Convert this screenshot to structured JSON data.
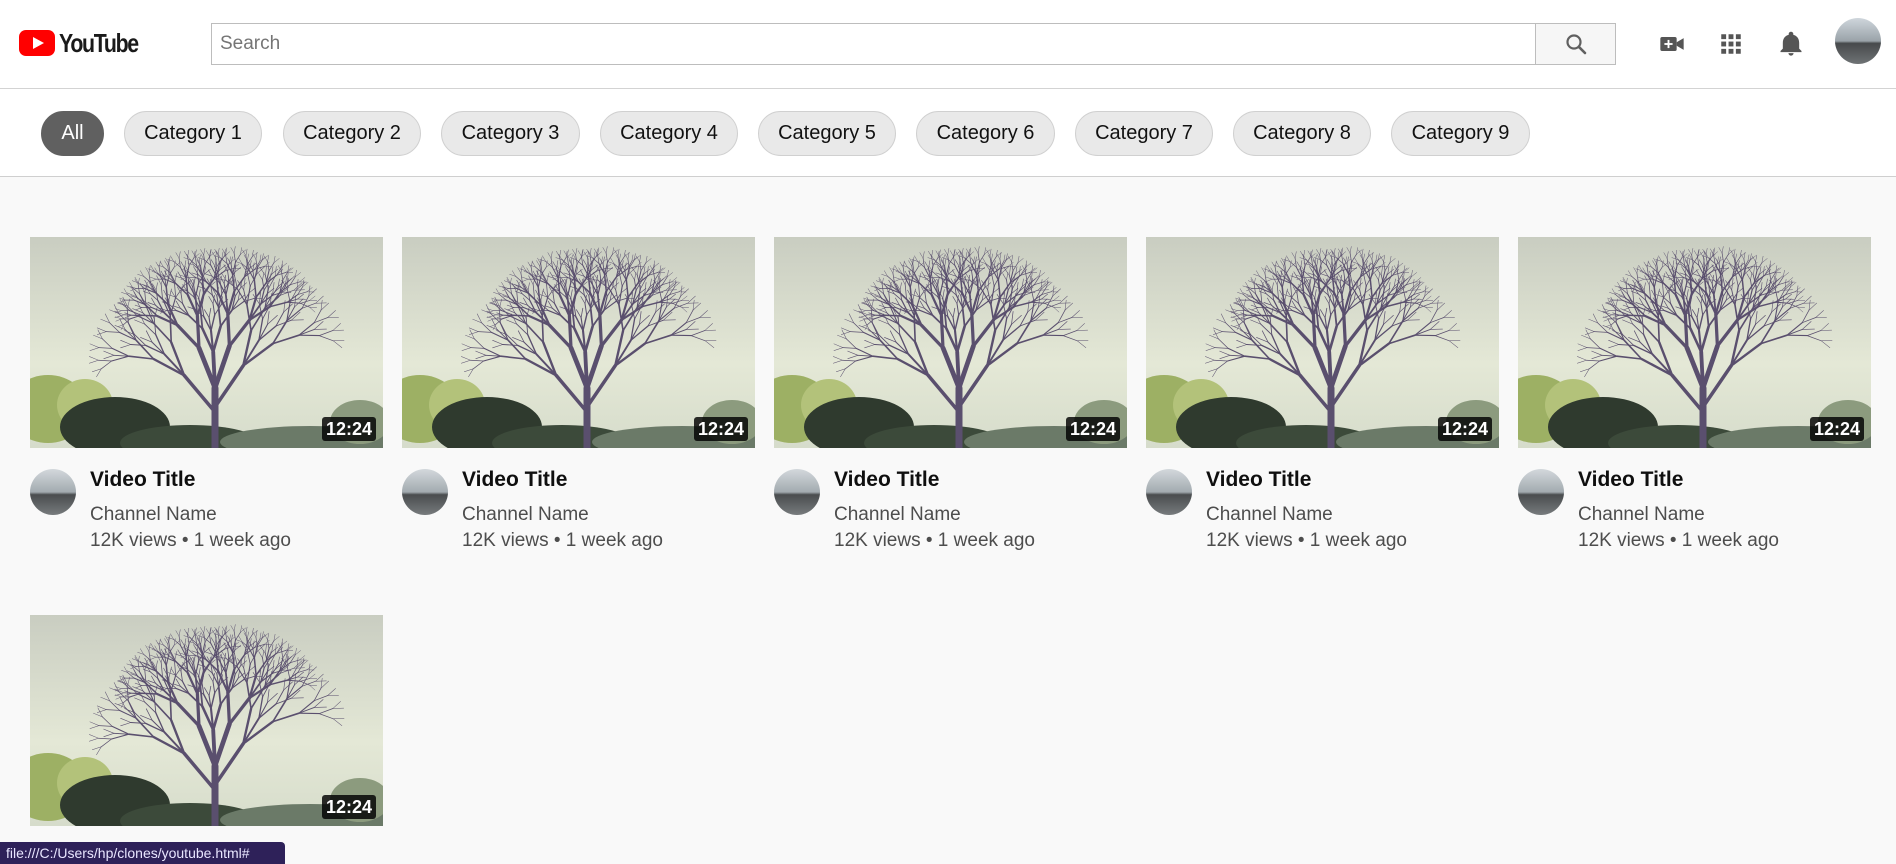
{
  "header": {
    "logo_text": "YouTube",
    "search_placeholder": "Search",
    "icons": [
      "search-icon",
      "video-camera-add-icon",
      "apps-grid-icon",
      "bell-icon"
    ]
  },
  "chips": [
    "All",
    "Category 1",
    "Category 2",
    "Category 3",
    "Category 4",
    "Category 5",
    "Category 6",
    "Category 7",
    "Category 8",
    "Category 9"
  ],
  "videos": [
    {
      "title": "Video Title",
      "channel": "Channel Name",
      "stats": "12K views • 1 week ago",
      "duration": "12:24"
    },
    {
      "title": "Video Title",
      "channel": "Channel Name",
      "stats": "12K views • 1 week ago",
      "duration": "12:24"
    },
    {
      "title": "Video Title",
      "channel": "Channel Name",
      "stats": "12K views • 1 week ago",
      "duration": "12:24"
    },
    {
      "title": "Video Title",
      "channel": "Channel Name",
      "stats": "12K views • 1 week ago",
      "duration": "12:24"
    },
    {
      "title": "Video Title",
      "channel": "Channel Name",
      "stats": "12K views • 1 week ago",
      "duration": "12:24"
    },
    {
      "title": "",
      "channel": "",
      "stats": "",
      "duration": "12:24"
    }
  ],
  "status_bar": {
    "url": "file:///C:/Users/hp/clones/youtube.html#"
  },
  "colors": {
    "brand_red": "#ff0000",
    "active_chip": "#606060",
    "chip_bg": "#e9e9e9",
    "page_bg": "#f9f9f9"
  }
}
